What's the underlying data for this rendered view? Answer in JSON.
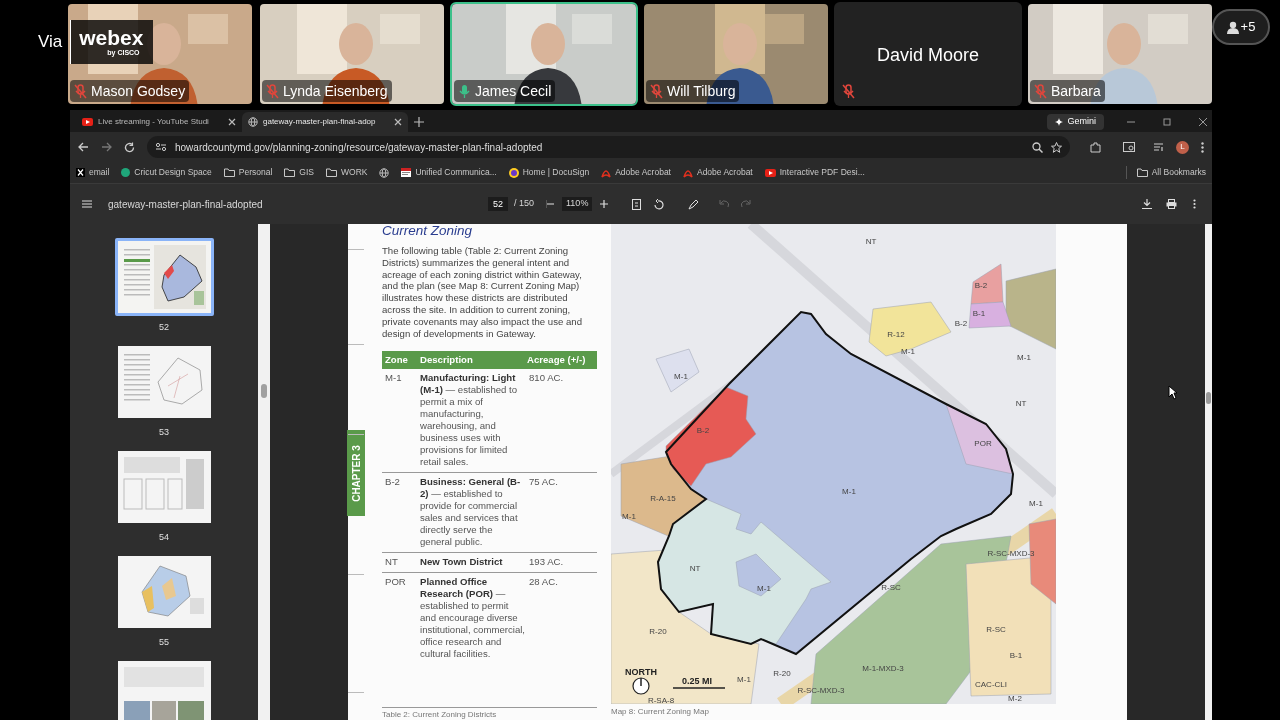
{
  "meeting": {
    "logo": {
      "via": "Via",
      "brand": "webex",
      "sub": "by CISCO"
    },
    "more_count": "+5",
    "participants": [
      {
        "name": "Mason Godsey",
        "muted": true,
        "active": false,
        "video": true
      },
      {
        "name": "Lynda Eisenberg",
        "muted": true,
        "active": false,
        "video": true
      },
      {
        "name": "James Cecil",
        "muted": false,
        "active": true,
        "video": true
      },
      {
        "name": "Will Tilburg",
        "muted": true,
        "active": false,
        "video": true
      },
      {
        "name": "David Moore",
        "muted": true,
        "active": false,
        "video": false
      },
      {
        "name": "Barbara",
        "muted": true,
        "active": false,
        "video": true
      }
    ]
  },
  "browser": {
    "tabs": [
      {
        "label": "Live streaming - YouTube Studi",
        "kind": "youtube",
        "selected": false
      },
      {
        "label": "gateway-master-plan-final-adop",
        "kind": "globe",
        "selected": true
      }
    ],
    "gemini": "Gemini",
    "url": "howardcountymd.gov/planning-zoning/resource/gateway-master-plan-final-adopted",
    "profile": "L",
    "bookmarks": [
      {
        "label": "email",
        "kind": "x"
      },
      {
        "label": "Cricut Design Space",
        "kind": "dot"
      },
      {
        "label": "Personal",
        "kind": "folder"
      },
      {
        "label": "GIS",
        "kind": "folder"
      },
      {
        "label": "WORK",
        "kind": "folder"
      },
      {
        "kind": "globe"
      },
      {
        "label": "Unified Communica...",
        "kind": "site"
      },
      {
        "label": "Home | DocuSign",
        "kind": "docusign"
      },
      {
        "label": "Adobe Acrobat",
        "kind": "acrobat"
      },
      {
        "label": "Adobe Acrobat",
        "kind": "acrobat"
      },
      {
        "label": "Interactive PDF Desi...",
        "kind": "youtube"
      }
    ],
    "all_bookmarks": "All Bookmarks"
  },
  "pdf_viewer": {
    "title": "gateway-master-plan-final-adopted",
    "page": "52",
    "total": "/ 150",
    "zoom": "110%",
    "thumbnails": [
      {
        "page": "52",
        "selected": true,
        "kind": "map"
      },
      {
        "page": "53",
        "selected": false,
        "kind": "outline"
      },
      {
        "page": "54",
        "selected": false,
        "kind": "text"
      },
      {
        "page": "55",
        "selected": false,
        "kind": "color"
      },
      {
        "selected": false,
        "kind": "photos"
      }
    ]
  },
  "document": {
    "chapter": "CHAPTER 3",
    "heading": "Current Zoning",
    "intro": "The following table (Table 2: Current Zoning Districts) summarizes the general intent and acreage of each zoning district within Gateway, and the plan (see Map 8: Current Zoning Map) illustrates how these districts are distributed across the site. In addition to current zoning, private covenants may also impact the use and design of developments in Gateway.",
    "table": {
      "columns": [
        "Zone",
        "Description",
        "Acreage (+/-)"
      ],
      "rows": [
        {
          "zone": "M-1",
          "name": "Manufacturing: Light (M-1)",
          "detail": " — established to permit a mix of manufacturing, warehousing, and business uses with provisions for limited retail sales.",
          "acreage": "810 AC."
        },
        {
          "zone": "B-2",
          "name": "Business: General (B-2)",
          "detail": " — established to provide for commercial sales and services that directly serve the general public.",
          "acreage": "75 AC."
        },
        {
          "zone": "NT",
          "name": "New Town District",
          "acreage": "193 AC."
        },
        {
          "zone": "POR",
          "name": "Planned Office Research (POR)",
          "detail": " — established to permit and encourage diverse institutional, commercial, office research and cultural facilities.",
          "acreage": "28 AC."
        }
      ]
    },
    "table_caption": "Table 2: Current Zoning Districts",
    "map": {
      "labels": [
        "NT",
        "R-12",
        "M-1",
        "B-2",
        "B-1",
        "B-2",
        "M-1",
        "NT",
        "M-1",
        "B-2",
        "POR",
        "R-A-15",
        "M-1",
        "M-1",
        "M-1",
        "NT",
        "M-1",
        "R-SC-MXD-3",
        "R-SC",
        "R-20",
        "R-SC",
        "B-1",
        "M-1-MXD-3",
        "R-20",
        "M-1",
        "R-SC-MXD-3",
        "CAC-CLI",
        "M-2",
        "R-SA-8"
      ],
      "north": "NORTH",
      "scale": "0.25 MI"
    },
    "map_caption": "Map 8:  Current Zoning Map"
  }
}
